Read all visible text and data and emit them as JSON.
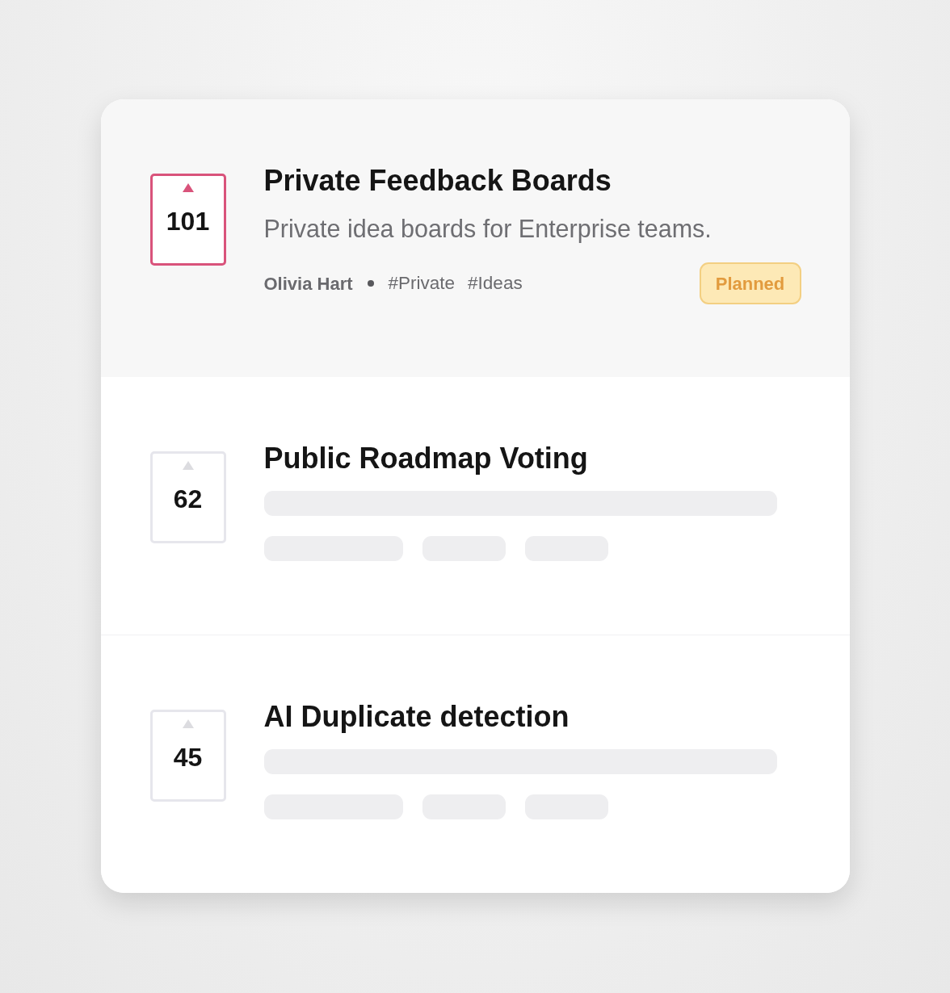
{
  "items": [
    {
      "kind": "full",
      "selected": true,
      "votes": "101",
      "title": "Private Feedback Boards",
      "description": "Private idea boards for Enterprise teams.",
      "author": "Olivia Hart",
      "tags": [
        "#Private",
        "#Ideas"
      ],
      "status": "Planned"
    },
    {
      "kind": "skeleton",
      "selected": false,
      "votes": "62",
      "title": "Public Roadmap Voting"
    },
    {
      "kind": "skeleton",
      "selected": false,
      "votes": "45",
      "title": "AI Duplicate detection"
    }
  ]
}
